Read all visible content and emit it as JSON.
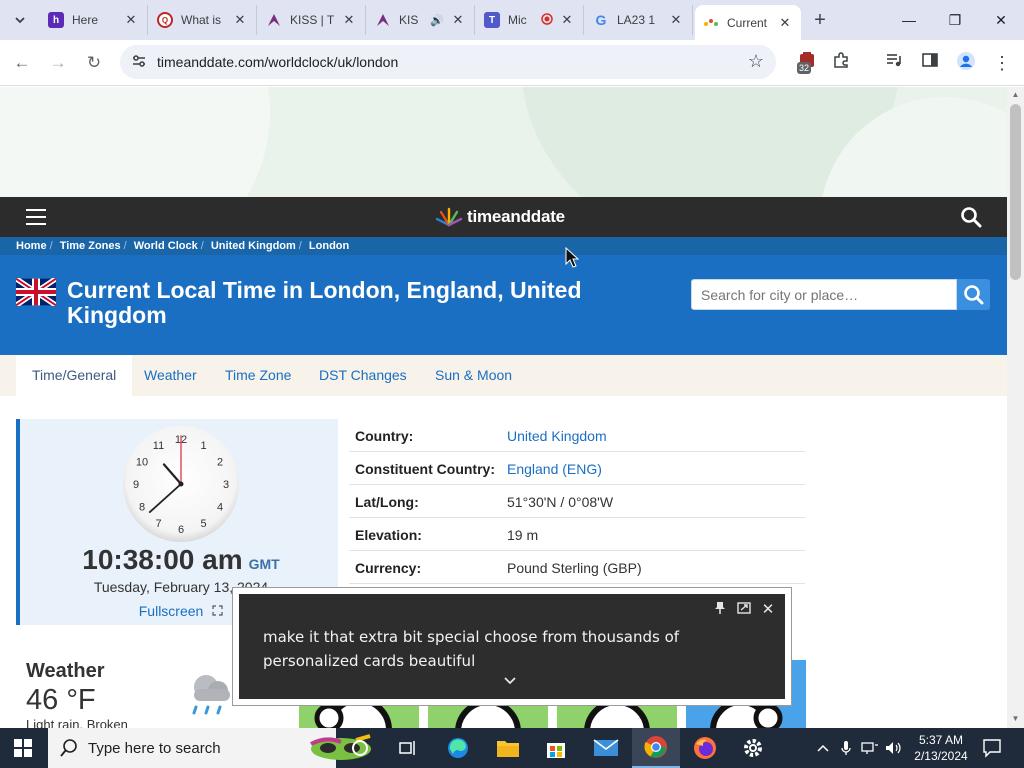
{
  "browser": {
    "tabs": [
      {
        "title": "Here",
        "favicon": "hopin-icon",
        "color": "#5b2bb5"
      },
      {
        "title": "What is",
        "favicon": "quora-icon",
        "color": "#b92b27"
      },
      {
        "title": "KISS | T",
        "favicon": "kiss-icon",
        "color": "#7b2d7e"
      },
      {
        "title": "KIS",
        "favicon": "kiss-icon",
        "color": "#7b2d7e",
        "audio": true
      },
      {
        "title": "Mic",
        "favicon": "teams-icon",
        "color": "#5059c9",
        "recording": true
      },
      {
        "title": "LA23 1",
        "favicon": "google-icon",
        "color": "#4285f4"
      },
      {
        "title": "Current",
        "favicon": "timeanddate-icon",
        "color": "#f9b200",
        "active": true
      }
    ],
    "url": "timeanddate.com/worldclock/uk/london",
    "extension_badge": "32"
  },
  "site": {
    "logo_text": "timeanddate",
    "breadcrumb": [
      "Home",
      "Time Zones",
      "World Clock",
      "United Kingdom",
      "London"
    ],
    "title": "Current Local Time in London, England, United Kingdom",
    "search_placeholder": "Search for city or place…",
    "tabs": [
      "Time/General",
      "Weather",
      "Time Zone",
      "DST Changes",
      "Sun & Moon"
    ],
    "active_tab": "Time/General"
  },
  "clock": {
    "time": "10:38:00 am",
    "timezone": "GMT",
    "date": "Tuesday, February 13, 2024",
    "fullscreen_label": "Fullscreen",
    "hours": 10,
    "minutes": 38,
    "seconds": 0
  },
  "info": [
    {
      "label": "Country:",
      "value": "United Kingdom",
      "link": true
    },
    {
      "label": "Constituent Country:",
      "value": "England (ENG)",
      "link": true
    },
    {
      "label": "Lat/Long:",
      "value": "51°30'N / 0°08'W",
      "link": false
    },
    {
      "label": "Elevation:",
      "value": "19 m",
      "link": false
    },
    {
      "label": "Currency:",
      "value": "Pound Sterling (GBP)",
      "link": false
    }
  ],
  "weather": {
    "title": "Weather",
    "temperature": "46 °F",
    "description": "Light rain. Broken"
  },
  "caption": {
    "text": "make it that extra bit special choose from thousands of personalized cards beautiful"
  },
  "taskbar": {
    "search_placeholder": "Type here to search",
    "time": "5:37 AM",
    "date": "2/13/2024"
  }
}
